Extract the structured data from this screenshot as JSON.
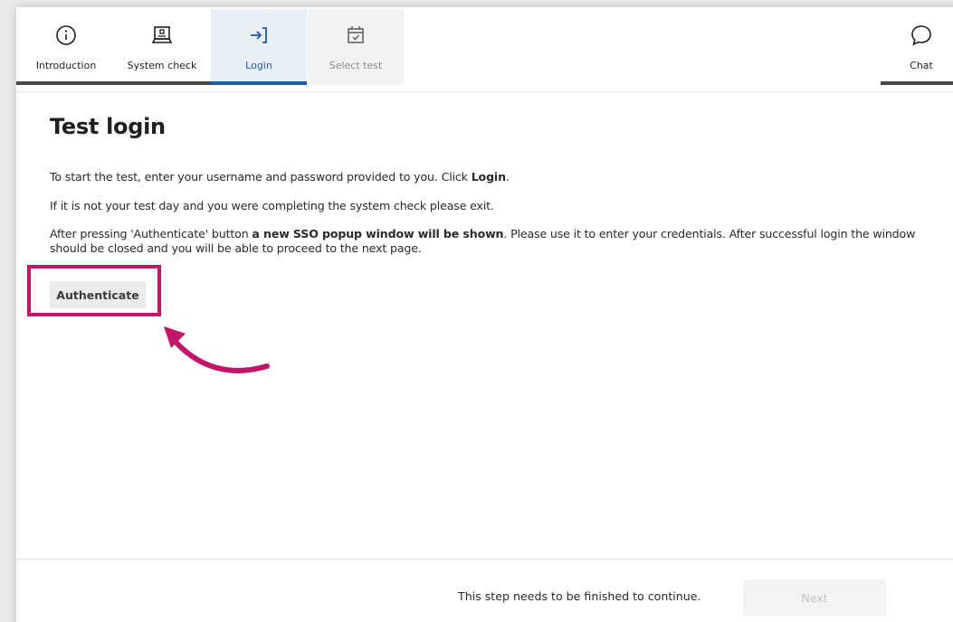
{
  "steps": [
    {
      "label": "Introduction",
      "icon": "info-icon"
    },
    {
      "label": "System check",
      "icon": "laptop-icon"
    },
    {
      "label": "Login",
      "icon": "login-icon"
    },
    {
      "label": "Select test",
      "icon": "calendar-icon"
    }
  ],
  "chat": {
    "label": "Chat",
    "icon": "chat-bubble-icon"
  },
  "main": {
    "title": "Test login",
    "p1_before": "To start the test, enter your username and password provided to you. Click ",
    "p1_bold": "Login",
    "p1_after": ".",
    "p2": "If it is not your test day and you were completing the system check please exit.",
    "p3_before": "After pressing 'Authenticate' button ",
    "p3_bold": "a new SSO popup window will be shown",
    "p3_after": ". Please use it to enter your credentials. After successful login the window should be closed and you will be able to proceed to the next page.",
    "authenticate_label": "Authenticate"
  },
  "footer": {
    "message": "This step needs to be finished to continue.",
    "next_label": "Next"
  },
  "colors": {
    "accent_blue": "#1e5aa8",
    "highlight_magenta": "#c2166b"
  }
}
